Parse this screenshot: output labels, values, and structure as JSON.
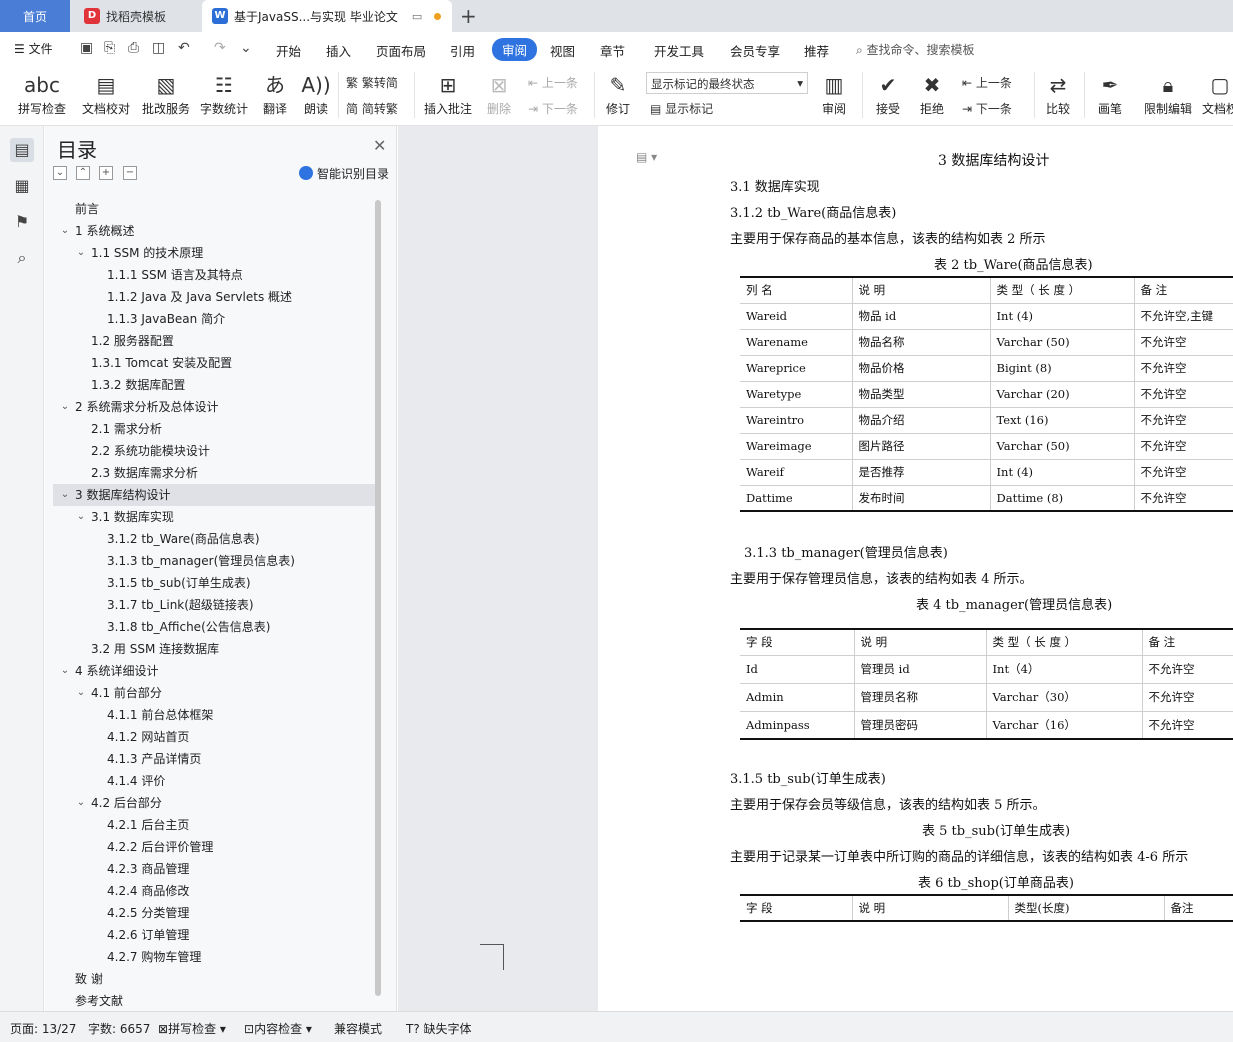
{
  "tabs": {
    "home": "首页",
    "template": "找稻壳模板",
    "doc": "基于JavaSS...与实现 毕业论文"
  },
  "menu": {
    "file": "文件",
    "items": [
      "开始",
      "插入",
      "页面布局",
      "引用",
      "审阅",
      "视图",
      "章节",
      "开发工具",
      "会员专享",
      "推荐"
    ],
    "search": "查找命令、搜索模板"
  },
  "ribbon": {
    "spell": "拼写检查",
    "proof": "文档校对",
    "batch": "批改服务",
    "wordcount": "字数统计",
    "translate": "翻译",
    "read": "朗读",
    "trad": "繁转简",
    "simp": "简转繁",
    "insert_comment": "插入批注",
    "delete": "删除",
    "prev": "上一条",
    "next": "下一条",
    "revise": "修订",
    "markup_state": "显示标记的最终状态",
    "show_markup": "显示标记",
    "review": "审阅",
    "accept": "接受",
    "reject": "拒绝",
    "prev2": "上一条",
    "next2": "下一条",
    "compare": "比较",
    "pen": "画笔",
    "restrict": "限制编辑",
    "docperm": "文档权"
  },
  "toc": {
    "title": "目录",
    "smart": "智能识别目录",
    "items": [
      {
        "t": "前言",
        "lv": 0,
        "c": ""
      },
      {
        "t": "1  系统概述",
        "lv": 0,
        "c": "v"
      },
      {
        "t": "1.1 SSM 的技术原理",
        "lv": 1,
        "c": "v"
      },
      {
        "t": "1.1.1 SSM 语言及其特点",
        "lv": 2,
        "c": ""
      },
      {
        "t": "1.1.2 Java 及 Java Servlets 概述",
        "lv": 2,
        "c": ""
      },
      {
        "t": "1.1.3 JavaBean 简介",
        "lv": 2,
        "c": ""
      },
      {
        "t": "1.2  服务器配置",
        "lv": 1,
        "c": ""
      },
      {
        "t": "1.3.1 Tomcat 安装及配置",
        "lv": 1,
        "c": ""
      },
      {
        "t": "1.3.2  数据库配置",
        "lv": 1,
        "c": ""
      },
      {
        "t": "2  系统需求分析及总体设计",
        "lv": 0,
        "c": "v"
      },
      {
        "t": "2.1  需求分析",
        "lv": 1,
        "c": ""
      },
      {
        "t": "2.2  系统功能模块设计",
        "lv": 1,
        "c": ""
      },
      {
        "t": "2.3  数据库需求分析",
        "lv": 1,
        "c": ""
      },
      {
        "t": "3  数据库结构设计",
        "lv": 0,
        "c": "v",
        "sel": true
      },
      {
        "t": "3.1  数据库实现",
        "lv": 1,
        "c": "v"
      },
      {
        "t": "3.1.2 tb_Ware(商品信息表)",
        "lv": 2,
        "c": ""
      },
      {
        "t": "3.1.3 tb_manager(管理员信息表)",
        "lv": 2,
        "c": ""
      },
      {
        "t": "3.1.5 tb_sub(订单生成表)",
        "lv": 2,
        "c": ""
      },
      {
        "t": "3.1.7 tb_Link(超级链接表)",
        "lv": 2,
        "c": ""
      },
      {
        "t": "3.1.8 tb_Affiche(公告信息表)",
        "lv": 2,
        "c": ""
      },
      {
        "t": "3.2 用 SSM 连接数据库",
        "lv": 1,
        "c": ""
      },
      {
        "t": "4  系统详细设计",
        "lv": 0,
        "c": "v"
      },
      {
        "t": "4.1  前台部分",
        "lv": 1,
        "c": "v"
      },
      {
        "t": "4.1.1  前台总体框架",
        "lv": 2,
        "c": ""
      },
      {
        "t": "4.1.2  网站首页",
        "lv": 2,
        "c": ""
      },
      {
        "t": "4.1.3  产品详情页",
        "lv": 2,
        "c": ""
      },
      {
        "t": "4.1.4  评价",
        "lv": 2,
        "c": ""
      },
      {
        "t": "4.2  后台部分",
        "lv": 1,
        "c": "v"
      },
      {
        "t": "4.2.1  后台主页",
        "lv": 2,
        "c": ""
      },
      {
        "t": "4.2.2  后台评价管理",
        "lv": 2,
        "c": ""
      },
      {
        "t": "4.2.3  商品管理",
        "lv": 2,
        "c": ""
      },
      {
        "t": "4.2.4  商品修改",
        "lv": 2,
        "c": ""
      },
      {
        "t": "4.2.5  分类管理",
        "lv": 2,
        "c": ""
      },
      {
        "t": "4.2.6  订单管理",
        "lv": 2,
        "c": ""
      },
      {
        "t": "4.2.7  购物车管理",
        "lv": 2,
        "c": ""
      },
      {
        "t": "致      谢",
        "lv": 0,
        "c": ""
      },
      {
        "t": "参考文献",
        "lv": 0,
        "c": ""
      }
    ]
  },
  "doc": {
    "h1": "3  数据库结构设计",
    "h2": "3.1  数据库实现",
    "h3a": "3.1.2 tb_Ware(商品信息表)",
    "p1": "主要用于保存商品的基本信息，该表的结构如表 2 所示",
    "cap2": "表 2    tb_Ware(商品信息表)",
    "table2": [
      [
        "列  名",
        "说  明",
        "类 型（ 长 度 ）",
        "备  注"
      ],
      [
        "Wareid",
        "物品 id",
        "Int   (4)",
        "不允许空,主键"
      ],
      [
        "Warename",
        "物品名称",
        "Varchar (50)",
        "不允许空"
      ],
      [
        "Wareprice",
        "物品价格",
        "Bigint (8)",
        "不允许空"
      ],
      [
        "Waretype",
        "物品类型",
        "Varchar (20)",
        "不允许空"
      ],
      [
        "Wareintro",
        "物品介绍",
        "Text (16)",
        "不允许空"
      ],
      [
        "Wareimage",
        "图片路径",
        "Varchar (50)",
        "不允许空"
      ],
      [
        "Wareif",
        "是否推荐",
        "Int (4)",
        "不允许空"
      ],
      [
        "Dattime",
        "发布时间",
        "Dattime (8)",
        "不允许空"
      ]
    ],
    "h3b": "3.1.3 tb_manager(管理员信息表)",
    "p2": "主要用于保存管理员信息，该表的结构如表 4 所示。",
    "cap4": "表 4    tb_manager(管理员信息表)",
    "table4": [
      [
        "字  段",
        "说  明",
        "类 型（ 长 度 ）",
        "备  注"
      ],
      [
        "Id",
        "管理员 id",
        "Int（4）",
        "不允许空"
      ],
      [
        "Admin",
        "管理员名称",
        "Varchar（30）",
        "不允许空"
      ],
      [
        "Adminpass",
        "管理员密码",
        "Varchar（16）",
        "不允许空"
      ]
    ],
    "h3c": "3.1.5 tb_sub(订单生成表)",
    "p3": "主要用于保存会员等级信息，该表的结构如表 5 所示。",
    "cap5": "表 5    tb_sub(订单生成表)",
    "p4": "主要用于记录某一订单表中所订购的商品的详细信息，该表的结构如表 4-6 所示",
    "cap6": "表 6    tb_shop(订单商品表)",
    "table6": [
      [
        "字  段",
        "说  明",
        "类型(长度)",
        "备注"
      ]
    ]
  },
  "status": {
    "page": "页面: 13/27",
    "words": "字数: 6657",
    "spell": "拼写检查",
    "content": "内容检查",
    "compat": "兼容模式",
    "font": "缺失字体"
  }
}
